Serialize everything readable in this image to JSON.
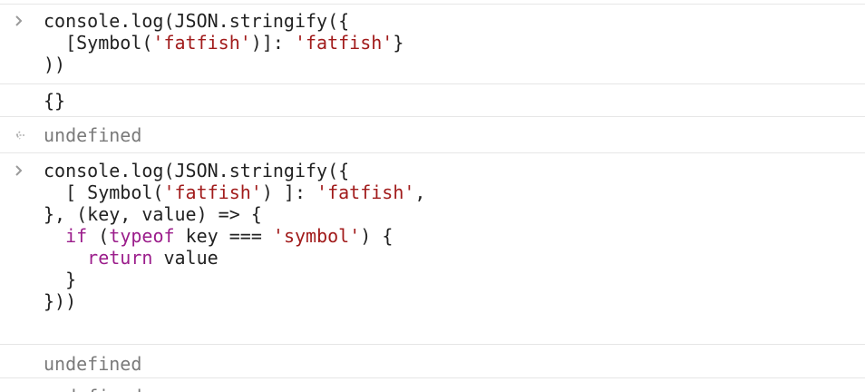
{
  "console": {
    "entries": [
      {
        "kind": "input",
        "lines": [
          [
            {
              "t": "console.log(JSON.stringify({",
              "c": "plain"
            }
          ],
          [
            {
              "t": "  [Symbol(",
              "c": "plain"
            },
            {
              "t": "'fatfish'",
              "c": "string"
            },
            {
              "t": ")]: ",
              "c": "plain"
            },
            {
              "t": "'fatfish'",
              "c": "string"
            },
            {
              "t": "}",
              "c": "plain"
            }
          ],
          [
            {
              "t": "))",
              "c": "plain"
            }
          ]
        ]
      },
      {
        "kind": "log",
        "lines": [
          [
            {
              "t": "{}",
              "c": "plain"
            }
          ]
        ]
      },
      {
        "kind": "return",
        "lines": [
          [
            {
              "t": "undefined",
              "c": "undef"
            }
          ]
        ]
      },
      {
        "kind": "input",
        "lines": [
          [
            {
              "t": "console.log(JSON.stringify({",
              "c": "plain"
            }
          ],
          [
            {
              "t": "  [ Symbol(",
              "c": "plain"
            },
            {
              "t": "'fatfish'",
              "c": "string"
            },
            {
              "t": ") ]: ",
              "c": "plain"
            },
            {
              "t": "'fatfish'",
              "c": "string"
            },
            {
              "t": ",",
              "c": "plain"
            }
          ],
          [
            {
              "t": "}, (key, value) => {",
              "c": "plain"
            }
          ],
          [
            {
              "t": "  ",
              "c": "plain"
            },
            {
              "t": "if",
              "c": "keyword"
            },
            {
              "t": " (",
              "c": "plain"
            },
            {
              "t": "typeof",
              "c": "keyword"
            },
            {
              "t": " key === ",
              "c": "plain"
            },
            {
              "t": "'symbol'",
              "c": "string"
            },
            {
              "t": ") {",
              "c": "plain"
            }
          ],
          [
            {
              "t": "    ",
              "c": "plain"
            },
            {
              "t": "return",
              "c": "keyword"
            },
            {
              "t": " value",
              "c": "plain"
            }
          ],
          [
            {
              "t": "  }",
              "c": "plain"
            }
          ],
          [
            {
              "t": "}))",
              "c": "plain"
            }
          ]
        ]
      },
      {
        "kind": "log",
        "lines": [
          [
            {
              "t": "undefined",
              "c": "undef"
            }
          ]
        ]
      },
      {
        "kind": "return",
        "lines": [
          [
            {
              "t": "undefined",
              "c": "undef"
            }
          ]
        ]
      }
    ],
    "icons": {
      "input": "chevron-right-icon",
      "return": "return-arrow-icon"
    },
    "colors": {
      "string": "#a11b1b",
      "keyword": "#9b1d8b",
      "text": "#222222",
      "muted": "#7a7a7a",
      "divider": "#e6e6e6"
    }
  }
}
